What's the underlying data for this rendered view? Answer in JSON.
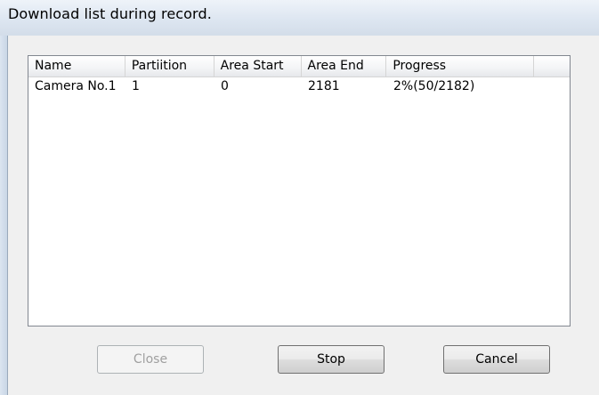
{
  "window": {
    "title": "Download list during record."
  },
  "list": {
    "columns": [
      "Name",
      "Partiition",
      "Area Start",
      "Area End",
      "Progress",
      ""
    ],
    "rows": [
      {
        "name": "Camera No.1",
        "partition": "1",
        "area_start": "0",
        "area_end": "2181",
        "progress": "2%(50/2182)"
      }
    ]
  },
  "buttons": {
    "close": "Close",
    "stop": "Stop",
    "cancel": "Cancel"
  },
  "state": {
    "close_enabled": false,
    "progress_percent": 2
  }
}
